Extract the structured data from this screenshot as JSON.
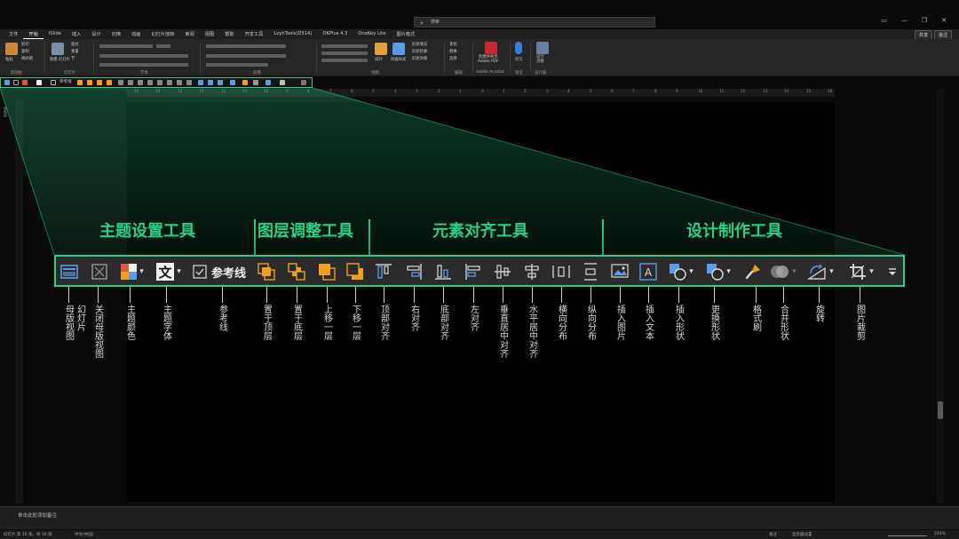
{
  "window": {
    "search_placeholder": "搜索",
    "search_icon": "search-icon",
    "controls": [
      "▭",
      "—",
      "❐",
      "✕"
    ]
  },
  "ribbon_tabs": [
    "文件",
    "开始",
    "iSlide",
    "插入",
    "设计",
    "切换",
    "动画",
    "幻灯片放映",
    "审阅",
    "视图",
    "帮助",
    "开发工具",
    "LvyhTools(D514)",
    "OKPlus 4.3",
    "OneKey Lite",
    "图片格式"
  ],
  "ribbon_actions": {
    "share": "共享",
    "comment": "批注"
  },
  "ribbon": {
    "groups": [
      "剪贴板",
      "幻灯片",
      "字体",
      "段落",
      "绘图",
      "编辑",
      "Adobe Acrobat",
      "语音",
      "设计器"
    ],
    "items": {
      "paste": "粘贴",
      "cut": "剪切",
      "copy": "复制",
      "format_painter": "格式刷",
      "new_slide": "新建\n幻灯片",
      "layout": "版式",
      "reset": "重置",
      "section": "节",
      "arrange": "排列",
      "quick_styles": "快速样式",
      "shape_fill": "形状填充",
      "shape_outline": "形状轮廓",
      "shape_effects": "形状效果",
      "find": "查找",
      "replace": "替换",
      "select": "选择",
      "create_pdf": "创建并共享\nAdobe PDF",
      "dictate": "听写",
      "designer": "设计\n灵感"
    }
  },
  "qat": {
    "guides_label": "参考线"
  },
  "ruler_ticks": [
    "16",
    "15",
    "14",
    "13",
    "12",
    "11",
    "10",
    "9",
    "8",
    "7",
    "6",
    "5",
    "4",
    "3",
    "2",
    "1",
    "0",
    "1",
    "2",
    "3",
    "4",
    "5",
    "6",
    "7",
    "8",
    "9",
    "10",
    "11",
    "12",
    "13",
    "14",
    "15",
    "16"
  ],
  "side_tab": "缩略图",
  "overlay": {
    "categories": [
      "主题设置工具",
      "图层调整工具",
      "元素对齐工具",
      "设计制作工具"
    ],
    "guides_label": "参考线",
    "tools": [
      {
        "icon": "slide-master-icon",
        "label": "母版视图",
        "label2": "幻灯片"
      },
      {
        "icon": "close-master-icon",
        "label": "关闭母版视图"
      },
      {
        "icon": "theme-colors-icon",
        "label": "主题颜色"
      },
      {
        "icon": "theme-fonts-icon",
        "label": "主题字体"
      },
      {
        "icon": "guides-checkbox-icon",
        "label": "参考线"
      },
      {
        "icon": "bring-to-front-icon",
        "label": "置于顶层"
      },
      {
        "icon": "send-to-back-icon",
        "label": "置于底层"
      },
      {
        "icon": "bring-forward-icon",
        "label": "上移一层"
      },
      {
        "icon": "send-backward-icon",
        "label": "下移一层"
      },
      {
        "icon": "align-top-icon",
        "label": "顶部对齐"
      },
      {
        "icon": "align-right-icon",
        "label": "右对齐"
      },
      {
        "icon": "align-bottom-icon",
        "label": "底部对齐"
      },
      {
        "icon": "align-left-icon",
        "label": "左对齐"
      },
      {
        "icon": "align-center-vertical-icon",
        "label": "垂直居中对齐"
      },
      {
        "icon": "align-center-horizontal-icon",
        "label": "水平居中对齐"
      },
      {
        "icon": "distribute-horizontal-icon",
        "label": "横向分布"
      },
      {
        "icon": "distribute-vertical-icon",
        "label": "纵向分布"
      },
      {
        "icon": "insert-picture-icon",
        "label": "插入图片"
      },
      {
        "icon": "insert-textbox-icon",
        "label": "插入文本"
      },
      {
        "icon": "insert-shape-icon",
        "label": "插入形状"
      },
      {
        "icon": "change-shape-icon",
        "label": "更换形状"
      },
      {
        "icon": "format-painter-icon",
        "label": "格式刷"
      },
      {
        "icon": "merge-shapes-icon",
        "label": "合并形状"
      },
      {
        "icon": "rotate-icon",
        "label": "旋转"
      },
      {
        "icon": "crop-icon",
        "label": "图片裁剪"
      },
      {
        "icon": "customize-qat-icon",
        "label": ""
      }
    ]
  },
  "notes_placeholder": "单击此处添加备注",
  "status": {
    "slide_info": "幻灯片 第 16 张，共 16 张",
    "language": "中文(中国)",
    "notes": "备注",
    "display": "显示器设置",
    "zoom": "140%"
  },
  "colors": {
    "accent_green": "#27d085",
    "toolbar_bg": "#2b2b2b",
    "orange": "#f0a020",
    "blue": "#5b9be8"
  }
}
